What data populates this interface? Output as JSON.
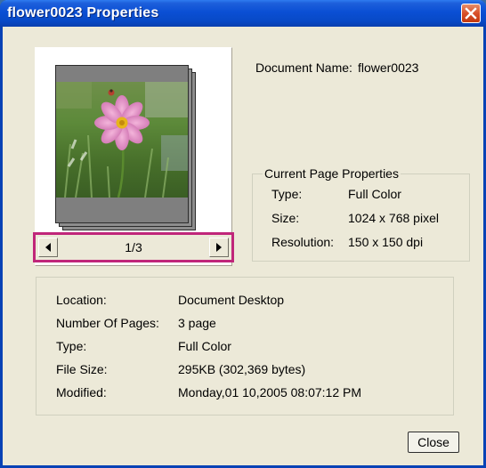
{
  "window": {
    "title": "flower0023 Properties"
  },
  "preview": {
    "image_description_icon": "flower-photo-thumbnail",
    "page_indicator": "1/3",
    "prev_icon": "triangle-left-icon",
    "next_icon": "triangle-right-icon"
  },
  "document": {
    "name_label": "Document Name:",
    "name_value": "flower0023"
  },
  "current_page": {
    "legend": "Current Page Properties",
    "type_label": "Type:",
    "type_value": "Full Color",
    "size_label": "Size:",
    "size_value": "1024 x 768 pixel",
    "resolution_label": "Resolution:",
    "resolution_value": "150 x 150 dpi"
  },
  "info": {
    "rows": [
      {
        "label": "Location:",
        "value": "Document Desktop"
      },
      {
        "label": "Number Of Pages:",
        "value": "3 page"
      },
      {
        "label": "Type:",
        "value": "Full Color"
      },
      {
        "label": "File Size:",
        "value": "295KB (302,369 bytes)"
      },
      {
        "label": "Modified:",
        "value": "Monday,01 10,2005 08:07:12 PM"
      }
    ]
  },
  "buttons": {
    "close_label": "Close"
  },
  "colors": {
    "titlebar": "#0a4fd4",
    "window_bg": "#ece9d8",
    "nav_highlight": "#c0267a",
    "close_x": "#d8502a"
  }
}
